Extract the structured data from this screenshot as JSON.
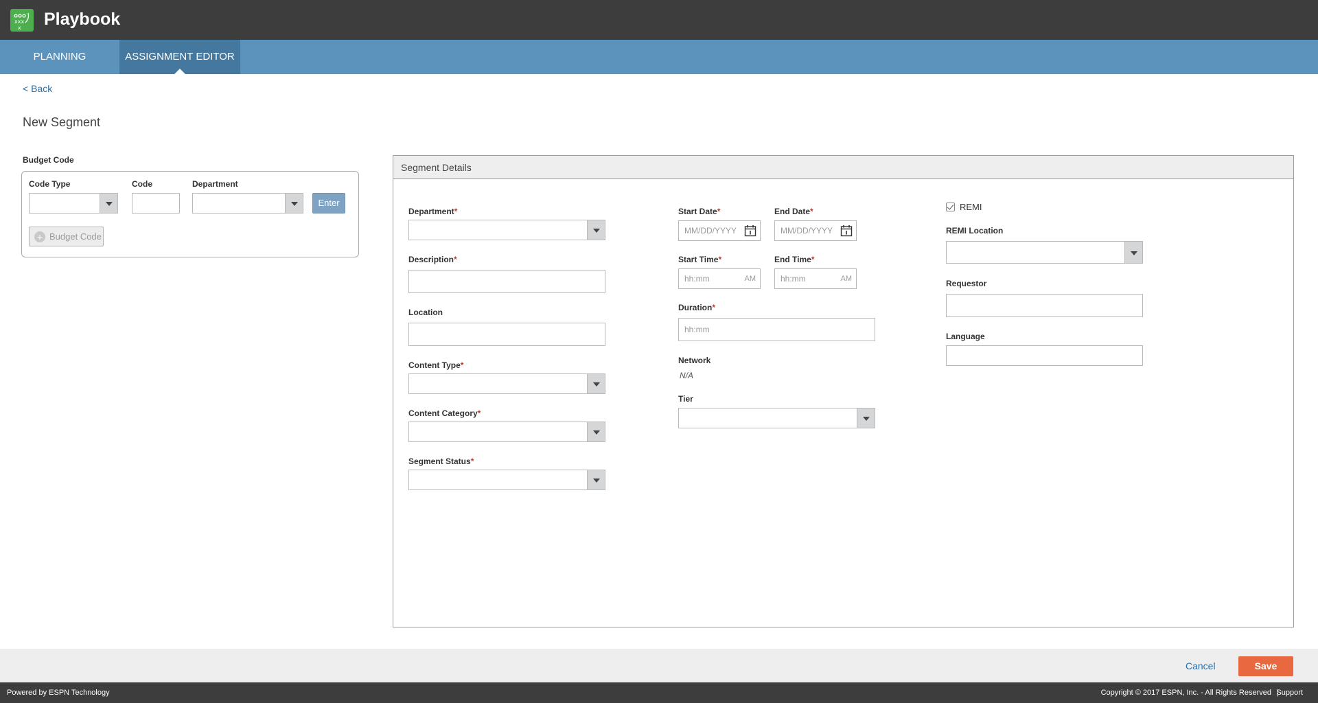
{
  "app": {
    "title": "Playbook"
  },
  "nav": {
    "tabs": [
      {
        "label": "PLANNING",
        "active": false
      },
      {
        "label": "ASSIGNMENT EDITOR",
        "active": true
      }
    ]
  },
  "page": {
    "back_label": "< Back",
    "title": "New Segment"
  },
  "budget": {
    "section_label": "Budget Code",
    "code_type_label": "Code Type",
    "code_label": "Code",
    "department_label": "Department",
    "enter_label": "Enter",
    "add_button_label": "Budget Code",
    "add_icon": "+"
  },
  "segment": {
    "panel_title": "Segment Details",
    "required_mark": "*",
    "department_label": "Department",
    "description_label": "Description",
    "location_label": "Location",
    "content_type_label": "Content Type",
    "content_category_label": "Content Category",
    "segment_status_label": "Segment Status",
    "start_date_label": "Start Date",
    "end_date_label": "End Date",
    "date_placeholder": "MM/DD/YYYY",
    "start_time_label": "Start Time",
    "end_time_label": "End Time",
    "time_placeholder": "hh:mm",
    "am_label": "AM",
    "duration_label": "Duration",
    "duration_placeholder": "hh:mm",
    "network_label": "Network",
    "network_value": "N/A",
    "tier_label": "Tier",
    "remi_label": "REMI",
    "remi_checked": true,
    "remi_location_label": "REMI Location",
    "requestor_label": "Requestor",
    "language_label": "Language"
  },
  "actions": {
    "cancel_label": "Cancel",
    "save_label": "Save"
  },
  "footer": {
    "powered_by": "Powered by ESPN Technology",
    "copyright": "Copyright © 2017 ESPN, Inc. - All Rights Reserved",
    "separator": "|",
    "support_label": "Support"
  },
  "colors": {
    "topbar": "#3d3d3d",
    "navbar": "#5b93bd",
    "nav_active": "#44789f",
    "logo": "#4cae4c",
    "save": "#e8683f",
    "link": "#2a6fa8"
  }
}
